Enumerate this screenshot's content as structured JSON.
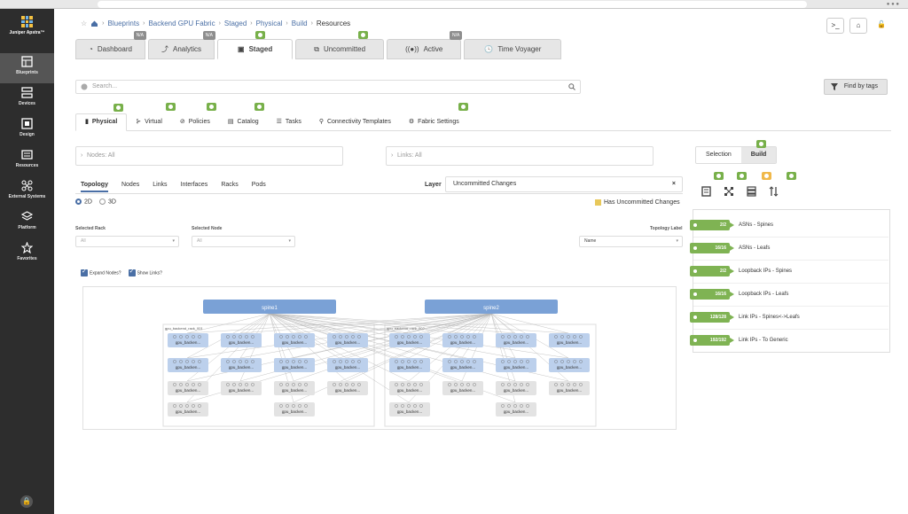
{
  "sidebar": {
    "logo_text": "Juniper Apstra™",
    "items": [
      {
        "label": "Blueprints",
        "icon": "blueprints-icon"
      },
      {
        "label": "Devices",
        "icon": "devices-icon"
      },
      {
        "label": "Design",
        "icon": "design-icon"
      },
      {
        "label": "Resources",
        "icon": "resources-icon"
      },
      {
        "label": "External Systems",
        "icon": "external-systems-icon"
      },
      {
        "label": "Platform",
        "icon": "platform-icon"
      },
      {
        "label": "Favorites",
        "icon": "star-icon"
      }
    ]
  },
  "breadcrumb": [
    "Blueprints",
    "Backend GPU Fabric",
    "Staged",
    "Physical",
    "Build",
    "Resources"
  ],
  "top_tabs": [
    {
      "label": "Dashboard",
      "badge": "N/A",
      "icon": "dashboard-icon"
    },
    {
      "label": "Analytics",
      "badge": "N/A",
      "icon": "analytics-icon"
    },
    {
      "label": "Staged",
      "icon": "staged-icon"
    },
    {
      "label": "Uncommitted",
      "icon": "uncommitted-icon"
    },
    {
      "label": "Active",
      "badge": "N/A",
      "icon": "active-icon"
    },
    {
      "label": "Time Voyager",
      "icon": "clock-icon"
    }
  ],
  "search": {
    "placeholder": "Search..."
  },
  "find_by_tags": "Find by tags",
  "sub_tabs": [
    {
      "label": "Physical"
    },
    {
      "label": "Virtual"
    },
    {
      "label": "Policies"
    },
    {
      "label": "Catalog"
    },
    {
      "label": "Tasks"
    },
    {
      "label": "Connectivity Templates"
    },
    {
      "label": "Fabric Settings"
    }
  ],
  "filters": {
    "nodes": "Nodes: All",
    "links": "Links: All"
  },
  "selection_build": {
    "selection": "Selection",
    "build": "Build"
  },
  "view_tabs": [
    "Topology",
    "Nodes",
    "Links",
    "Interfaces",
    "Racks",
    "Pods"
  ],
  "layer": {
    "label": "Layer",
    "value": "Uncommitted Changes"
  },
  "dims": {
    "d2": "2D",
    "d3": "3D"
  },
  "has_uncommitted": "Has Uncommitted Changes",
  "selected_rack": {
    "label": "Selected Rack",
    "value": "All"
  },
  "selected_node": {
    "label": "Selected Node",
    "value": "All"
  },
  "topology_label": {
    "label": "Topology Label",
    "value": "Name"
  },
  "checkboxes": {
    "expand_nodes": "Expand Nodes?",
    "show_links": "Show Links?"
  },
  "topology": {
    "spines": [
      "spine1",
      "spine2"
    ],
    "group_labels": [
      "gpu_backend_rack_001",
      "gpu_backend_rack_002"
    ],
    "leaf_label": "gpu_backen..."
  },
  "resources": [
    {
      "value": "2/2",
      "label": "ASNs - Spines"
    },
    {
      "value": "16/16",
      "label": "ASNs - Leafs"
    },
    {
      "value": "2/2",
      "label": "Loopback IPs - Spines"
    },
    {
      "value": "16/16",
      "label": "Loopback IPs - Leafs"
    },
    {
      "value": "128/128",
      "label": "Link IPs - Spines<->Leafs"
    },
    {
      "value": "192/192",
      "label": "Link IPs - To Generic"
    }
  ],
  "colors": {
    "accent": "#4a6fa5",
    "badge_green": "#78b04a",
    "sidebar": "#2d2d2d",
    "pill": "#7fb353"
  }
}
